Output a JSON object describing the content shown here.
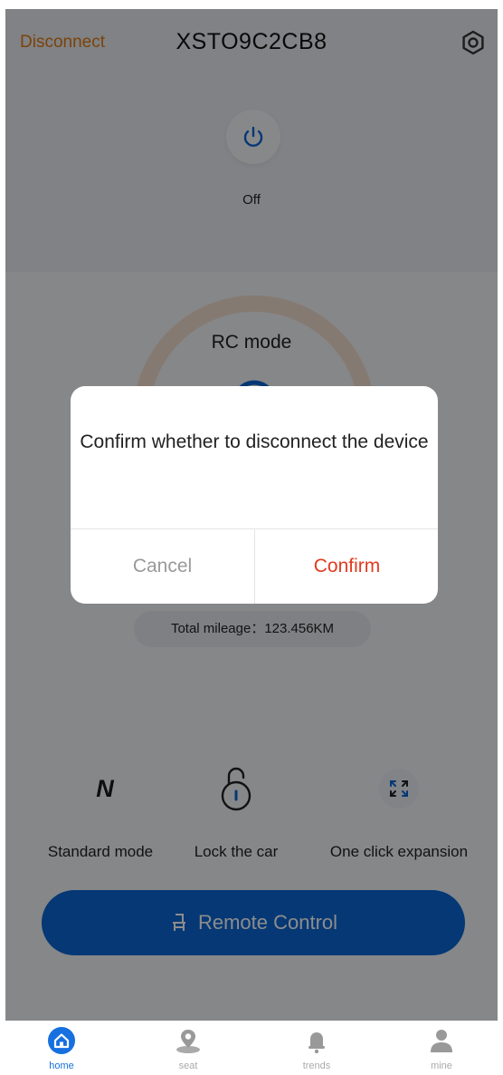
{
  "header": {
    "disconnect_label": "Disconnect",
    "device_id": "XSTO9C2CB8",
    "settings_icon": "gear-icon"
  },
  "power": {
    "icon": "power-icon",
    "status": "Off"
  },
  "gauge": {
    "mode_label": "RC mode"
  },
  "stats": {
    "mileage_text": "Total mileage：123.456KM"
  },
  "controls": [
    {
      "label": "Standard mode",
      "icon": "mode-n-icon",
      "glyph": "N"
    },
    {
      "label": "Lock the car",
      "icon": "lock-icon"
    },
    {
      "label": "One click expansion",
      "icon": "expand-icon"
    }
  ],
  "remote_control": {
    "label": "Remote Control",
    "icon": "seat-icon"
  },
  "dialog": {
    "message": "Confirm whether to disconnect the device",
    "cancel_label": "Cancel",
    "confirm_label": "Confirm"
  },
  "tabbar": {
    "items": [
      {
        "label": "home",
        "icon": "home-icon",
        "active": true
      },
      {
        "label": "seat",
        "icon": "map-pin-icon",
        "active": false
      },
      {
        "label": "trends",
        "icon": "bell-icon",
        "active": false
      },
      {
        "label": "mine",
        "icon": "user-icon",
        "active": false
      }
    ]
  },
  "colors": {
    "accent": "#0a66d6",
    "disconnect": "#e07b12",
    "confirm": "#e23b1f",
    "tab_active": "#1670e0",
    "tab_inactive": "#aaaaaa"
  }
}
